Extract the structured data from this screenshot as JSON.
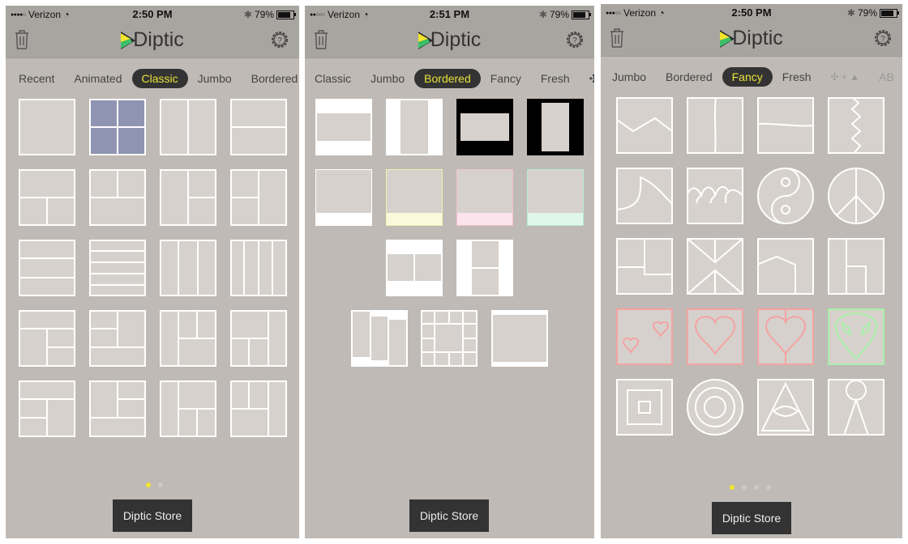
{
  "colors": {
    "background": "#bfbab5",
    "header": "#a8a5a1",
    "tile": "#d6d1cc",
    "accent": "#e8e13a",
    "pill": "#333333",
    "heart_pink": "#f4a3a3",
    "alien_green": "#a8f0a8",
    "quad_blue": "#8f94b2"
  },
  "panels": [
    {
      "status": {
        "signal_filled": 4,
        "signal_total": 5,
        "carrier": "Verizon",
        "time": "2:50 PM",
        "battery": "79%"
      },
      "logo": "Diptic",
      "tabs": [
        "Recent",
        "Animated",
        "Classic",
        "Jumbo",
        "Bordered"
      ],
      "active_tab": "Classic",
      "page_dots": 2,
      "active_dot": 0,
      "store_label": "Diptic Store"
    },
    {
      "status": {
        "signal_filled": 2,
        "signal_total": 5,
        "carrier": "Verizon",
        "time": "2:51 PM",
        "battery": "79%"
      },
      "logo": "Diptic",
      "tabs": [
        "Classic",
        "Jumbo",
        "Bordered",
        "Fancy",
        "Fresh",
        "✣"
      ],
      "active_tab": "Bordered",
      "page_dots": 0,
      "active_dot": 0,
      "store_label": "Diptic Store"
    },
    {
      "status": {
        "signal_filled": 3,
        "signal_total": 5,
        "carrier": "Verizon",
        "time": "2:50 PM",
        "battery": "79%"
      },
      "logo": "Diptic",
      "tabs": [
        "Jumbo",
        "Bordered",
        "Fancy",
        "Fresh",
        "✣ + ▲",
        "AB"
      ],
      "active_tab": "Fancy",
      "page_dots": 4,
      "active_dot": 0,
      "store_label": "Diptic Store"
    }
  ],
  "icons": {
    "left": "trash-icon",
    "right": "help-gear-icon",
    "wifi": "wifi-icon",
    "bluetooth": "bluetooth-icon",
    "battery": "battery-icon"
  }
}
